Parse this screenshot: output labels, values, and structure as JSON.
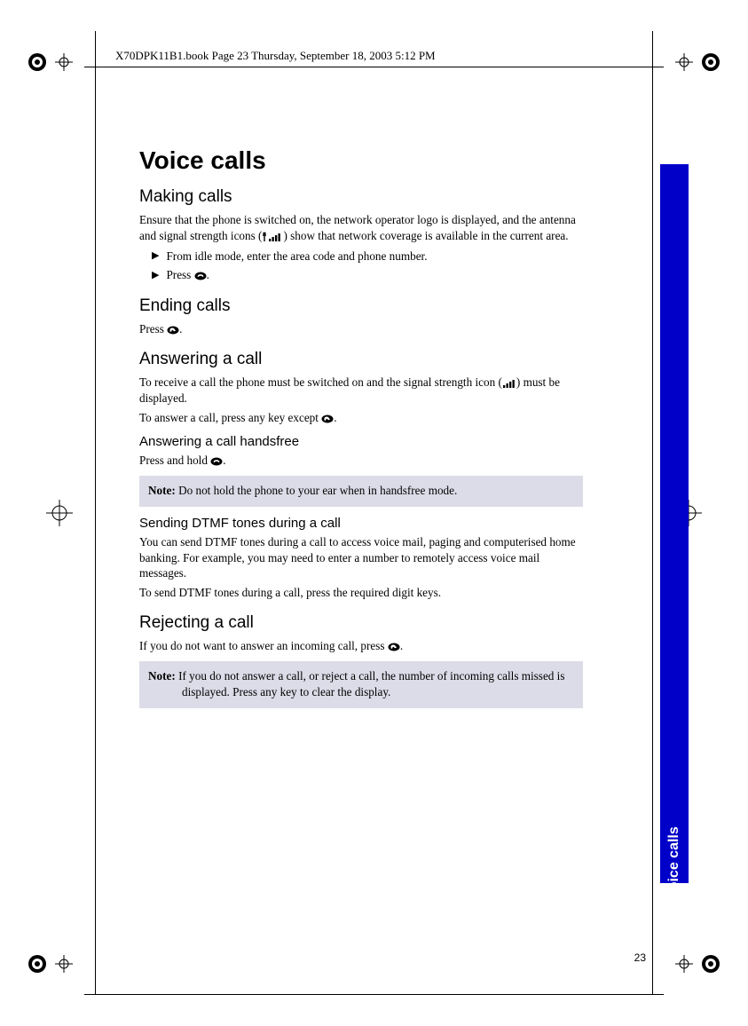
{
  "header": "X70DPK11B1.book  Page 23  Thursday, September 18, 2003  5:12 PM",
  "page_number": "23",
  "side_tab": "Voice calls",
  "h1": "Voice calls",
  "making_calls": {
    "heading": "Making calls",
    "intro_a": "Ensure that the phone is switched on, the network operator logo is displayed, and the antenna and signal strength icons (",
    "intro_b": ") show that network coverage is available in the current area.",
    "step1": "From idle mode, enter the area code and phone number.",
    "step2_a": "Press ",
    "step2_b": "."
  },
  "ending_calls": {
    "heading": "Ending calls",
    "text_a": "Press ",
    "text_b": "."
  },
  "answering": {
    "heading": "Answering a call",
    "para1_a": "To receive a call the phone must be switched on and the signal strength icon (",
    "para1_b": ") must be displayed.",
    "para2_a": "To answer a call, press any key except ",
    "para2_b": "."
  },
  "handsfree": {
    "heading": "Answering a call handsfree",
    "text_a": "Press and hold ",
    "text_b": ".",
    "note_label": "Note:",
    "note_text": " Do not hold the phone to your ear when in handsfree mode."
  },
  "dtmf": {
    "heading": "Sending DTMF tones during a call",
    "para1": "You can send DTMF tones during a call to access voice mail, paging and computerised home banking. For example, you may need to enter a number to remotely access voice mail messages.",
    "para2": "To send DTMF tones during a call, press the required digit keys."
  },
  "rejecting": {
    "heading": "Rejecting a call",
    "text_a": "If you do not want to answer an incoming call, press ",
    "text_b": ".",
    "note_label": "Note:",
    "note_text": " If you do not answer a call, or reject a call, the number of incoming calls missed is displayed. Press any key to clear the display."
  }
}
